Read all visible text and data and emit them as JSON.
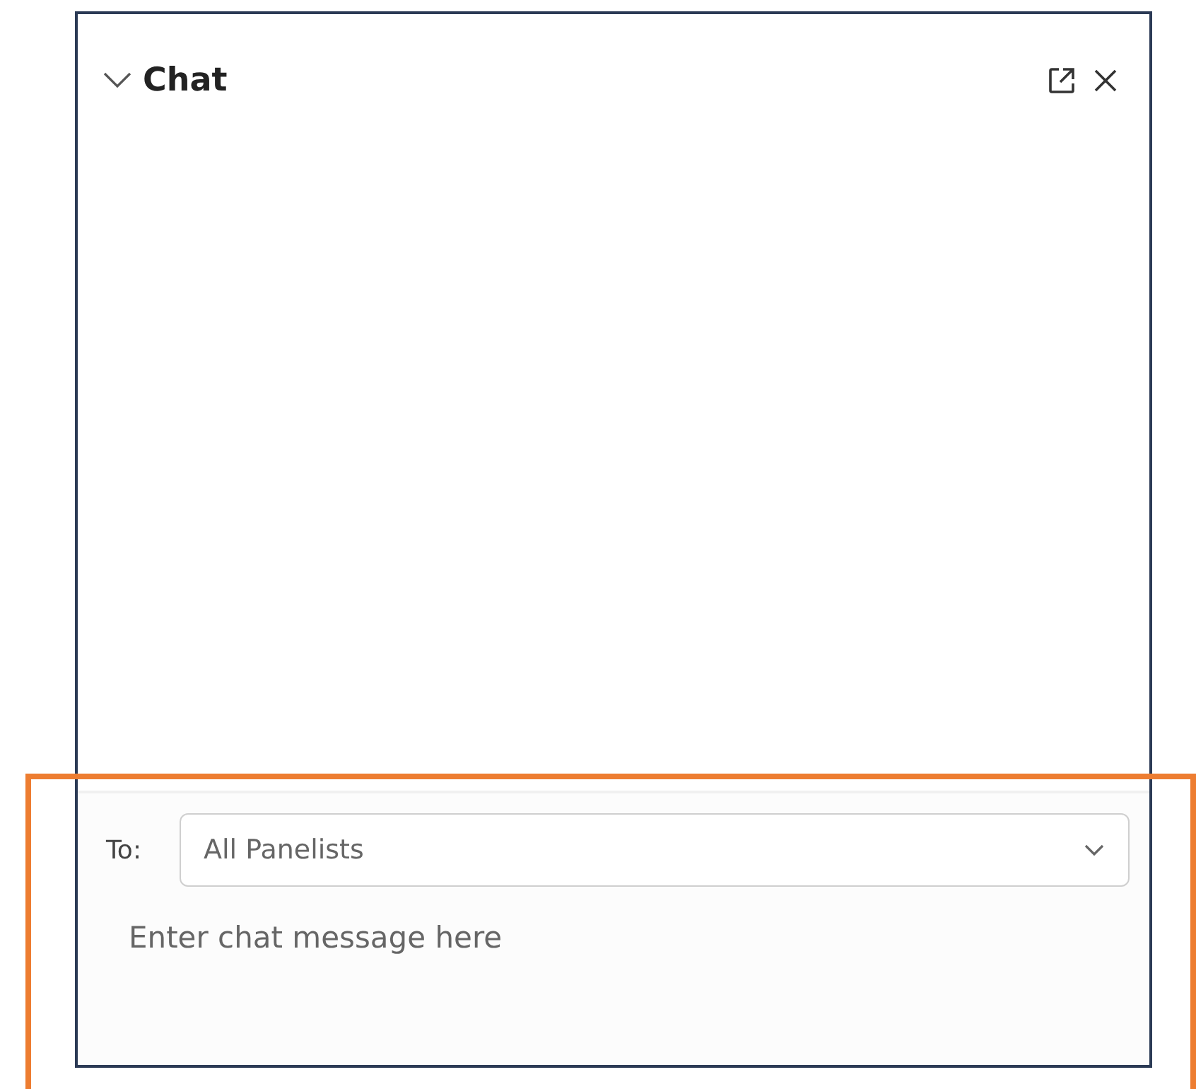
{
  "panel": {
    "title": "Chat",
    "expanded": true
  },
  "recipient": {
    "label": "To:",
    "value": "All Panelists"
  },
  "message": {
    "placeholder": "Enter chat message here"
  }
}
